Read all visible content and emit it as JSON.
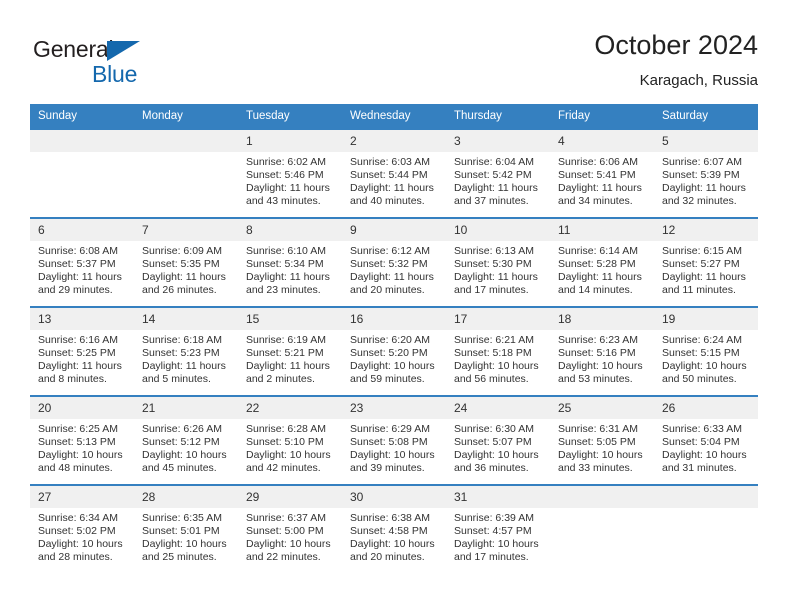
{
  "brand": {
    "name_top": "General",
    "name_bottom": "Blue",
    "triangle_color": "#1468ad",
    "text_color": "#231f20"
  },
  "header": {
    "title": "October 2024",
    "subtitle": "Karagach, Russia"
  },
  "theme": {
    "header_blue": "#3580c0",
    "daynum_bg": "#f0f0f0",
    "text": "#333333"
  },
  "weekday_headers": [
    "Sunday",
    "Monday",
    "Tuesday",
    "Wednesday",
    "Thursday",
    "Friday",
    "Saturday"
  ],
  "weeks": [
    [
      {
        "day": "",
        "empty": true
      },
      {
        "day": "",
        "empty": true
      },
      {
        "day": "1",
        "sunrise": "Sunrise: 6:02 AM",
        "sunset": "Sunset: 5:46 PM",
        "daylight_line1": "Daylight: 11 hours",
        "daylight_line2": "and 43 minutes."
      },
      {
        "day": "2",
        "sunrise": "Sunrise: 6:03 AM",
        "sunset": "Sunset: 5:44 PM",
        "daylight_line1": "Daylight: 11 hours",
        "daylight_line2": "and 40 minutes."
      },
      {
        "day": "3",
        "sunrise": "Sunrise: 6:04 AM",
        "sunset": "Sunset: 5:42 PM",
        "daylight_line1": "Daylight: 11 hours",
        "daylight_line2": "and 37 minutes."
      },
      {
        "day": "4",
        "sunrise": "Sunrise: 6:06 AM",
        "sunset": "Sunset: 5:41 PM",
        "daylight_line1": "Daylight: 11 hours",
        "daylight_line2": "and 34 minutes."
      },
      {
        "day": "5",
        "sunrise": "Sunrise: 6:07 AM",
        "sunset": "Sunset: 5:39 PM",
        "daylight_line1": "Daylight: 11 hours",
        "daylight_line2": "and 32 minutes."
      }
    ],
    [
      {
        "day": "6",
        "sunrise": "Sunrise: 6:08 AM",
        "sunset": "Sunset: 5:37 PM",
        "daylight_line1": "Daylight: 11 hours",
        "daylight_line2": "and 29 minutes."
      },
      {
        "day": "7",
        "sunrise": "Sunrise: 6:09 AM",
        "sunset": "Sunset: 5:35 PM",
        "daylight_line1": "Daylight: 11 hours",
        "daylight_line2": "and 26 minutes."
      },
      {
        "day": "8",
        "sunrise": "Sunrise: 6:10 AM",
        "sunset": "Sunset: 5:34 PM",
        "daylight_line1": "Daylight: 11 hours",
        "daylight_line2": "and 23 minutes."
      },
      {
        "day": "9",
        "sunrise": "Sunrise: 6:12 AM",
        "sunset": "Sunset: 5:32 PM",
        "daylight_line1": "Daylight: 11 hours",
        "daylight_line2": "and 20 minutes."
      },
      {
        "day": "10",
        "sunrise": "Sunrise: 6:13 AM",
        "sunset": "Sunset: 5:30 PM",
        "daylight_line1": "Daylight: 11 hours",
        "daylight_line2": "and 17 minutes."
      },
      {
        "day": "11",
        "sunrise": "Sunrise: 6:14 AM",
        "sunset": "Sunset: 5:28 PM",
        "daylight_line1": "Daylight: 11 hours",
        "daylight_line2": "and 14 minutes."
      },
      {
        "day": "12",
        "sunrise": "Sunrise: 6:15 AM",
        "sunset": "Sunset: 5:27 PM",
        "daylight_line1": "Daylight: 11 hours",
        "daylight_line2": "and 11 minutes."
      }
    ],
    [
      {
        "day": "13",
        "sunrise": "Sunrise: 6:16 AM",
        "sunset": "Sunset: 5:25 PM",
        "daylight_line1": "Daylight: 11 hours",
        "daylight_line2": "and 8 minutes."
      },
      {
        "day": "14",
        "sunrise": "Sunrise: 6:18 AM",
        "sunset": "Sunset: 5:23 PM",
        "daylight_line1": "Daylight: 11 hours",
        "daylight_line2": "and 5 minutes."
      },
      {
        "day": "15",
        "sunrise": "Sunrise: 6:19 AM",
        "sunset": "Sunset: 5:21 PM",
        "daylight_line1": "Daylight: 11 hours",
        "daylight_line2": "and 2 minutes."
      },
      {
        "day": "16",
        "sunrise": "Sunrise: 6:20 AM",
        "sunset": "Sunset: 5:20 PM",
        "daylight_line1": "Daylight: 10 hours",
        "daylight_line2": "and 59 minutes."
      },
      {
        "day": "17",
        "sunrise": "Sunrise: 6:21 AM",
        "sunset": "Sunset: 5:18 PM",
        "daylight_line1": "Daylight: 10 hours",
        "daylight_line2": "and 56 minutes."
      },
      {
        "day": "18",
        "sunrise": "Sunrise: 6:23 AM",
        "sunset": "Sunset: 5:16 PM",
        "daylight_line1": "Daylight: 10 hours",
        "daylight_line2": "and 53 minutes."
      },
      {
        "day": "19",
        "sunrise": "Sunrise: 6:24 AM",
        "sunset": "Sunset: 5:15 PM",
        "daylight_line1": "Daylight: 10 hours",
        "daylight_line2": "and 50 minutes."
      }
    ],
    [
      {
        "day": "20",
        "sunrise": "Sunrise: 6:25 AM",
        "sunset": "Sunset: 5:13 PM",
        "daylight_line1": "Daylight: 10 hours",
        "daylight_line2": "and 48 minutes."
      },
      {
        "day": "21",
        "sunrise": "Sunrise: 6:26 AM",
        "sunset": "Sunset: 5:12 PM",
        "daylight_line1": "Daylight: 10 hours",
        "daylight_line2": "and 45 minutes."
      },
      {
        "day": "22",
        "sunrise": "Sunrise: 6:28 AM",
        "sunset": "Sunset: 5:10 PM",
        "daylight_line1": "Daylight: 10 hours",
        "daylight_line2": "and 42 minutes."
      },
      {
        "day": "23",
        "sunrise": "Sunrise: 6:29 AM",
        "sunset": "Sunset: 5:08 PM",
        "daylight_line1": "Daylight: 10 hours",
        "daylight_line2": "and 39 minutes."
      },
      {
        "day": "24",
        "sunrise": "Sunrise: 6:30 AM",
        "sunset": "Sunset: 5:07 PM",
        "daylight_line1": "Daylight: 10 hours",
        "daylight_line2": "and 36 minutes."
      },
      {
        "day": "25",
        "sunrise": "Sunrise: 6:31 AM",
        "sunset": "Sunset: 5:05 PM",
        "daylight_line1": "Daylight: 10 hours",
        "daylight_line2": "and 33 minutes."
      },
      {
        "day": "26",
        "sunrise": "Sunrise: 6:33 AM",
        "sunset": "Sunset: 5:04 PM",
        "daylight_line1": "Daylight: 10 hours",
        "daylight_line2": "and 31 minutes."
      }
    ],
    [
      {
        "day": "27",
        "sunrise": "Sunrise: 6:34 AM",
        "sunset": "Sunset: 5:02 PM",
        "daylight_line1": "Daylight: 10 hours",
        "daylight_line2": "and 28 minutes."
      },
      {
        "day": "28",
        "sunrise": "Sunrise: 6:35 AM",
        "sunset": "Sunset: 5:01 PM",
        "daylight_line1": "Daylight: 10 hours",
        "daylight_line2": "and 25 minutes."
      },
      {
        "day": "29",
        "sunrise": "Sunrise: 6:37 AM",
        "sunset": "Sunset: 5:00 PM",
        "daylight_line1": "Daylight: 10 hours",
        "daylight_line2": "and 22 minutes."
      },
      {
        "day": "30",
        "sunrise": "Sunrise: 6:38 AM",
        "sunset": "Sunset: 4:58 PM",
        "daylight_line1": "Daylight: 10 hours",
        "daylight_line2": "and 20 minutes."
      },
      {
        "day": "31",
        "sunrise": "Sunrise: 6:39 AM",
        "sunset": "Sunset: 4:57 PM",
        "daylight_line1": "Daylight: 10 hours",
        "daylight_line2": "and 17 minutes."
      },
      {
        "day": "",
        "empty": true
      },
      {
        "day": "",
        "empty": true
      }
    ]
  ]
}
